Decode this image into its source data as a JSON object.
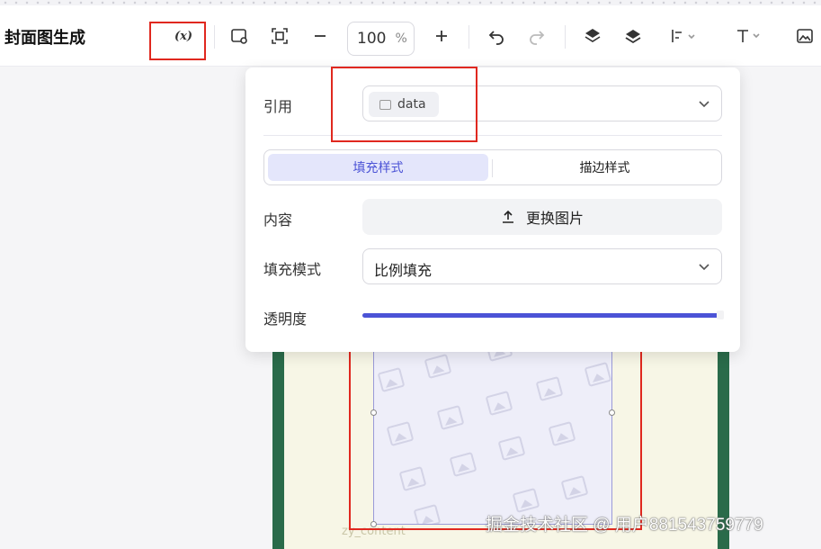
{
  "app": {
    "title": "封面图生成"
  },
  "toolbar": {
    "variable_label": "(x)",
    "zoom_value": "100",
    "zoom_unit": "%"
  },
  "panel": {
    "reference_label": "引用",
    "reference_value": "data",
    "tabs": [
      {
        "label": "填充样式",
        "active": true
      },
      {
        "label": "描边样式",
        "active": false
      }
    ],
    "content_label": "内容",
    "replace_image_label": "更换图片",
    "fill_mode_label": "填充模式",
    "fill_mode_value": "比例填充",
    "opacity_label": "透明度",
    "opacity_percent": 100
  },
  "canvas": {
    "layer_name": "zy_content"
  },
  "watermark": "掘金技术社区 @ 用户881543759779",
  "colors": {
    "accent": "#4b53d6",
    "highlight_border": "#e0281f",
    "frame_green": "#2a6b4a",
    "artboard_bg": "#f7f6e6"
  }
}
